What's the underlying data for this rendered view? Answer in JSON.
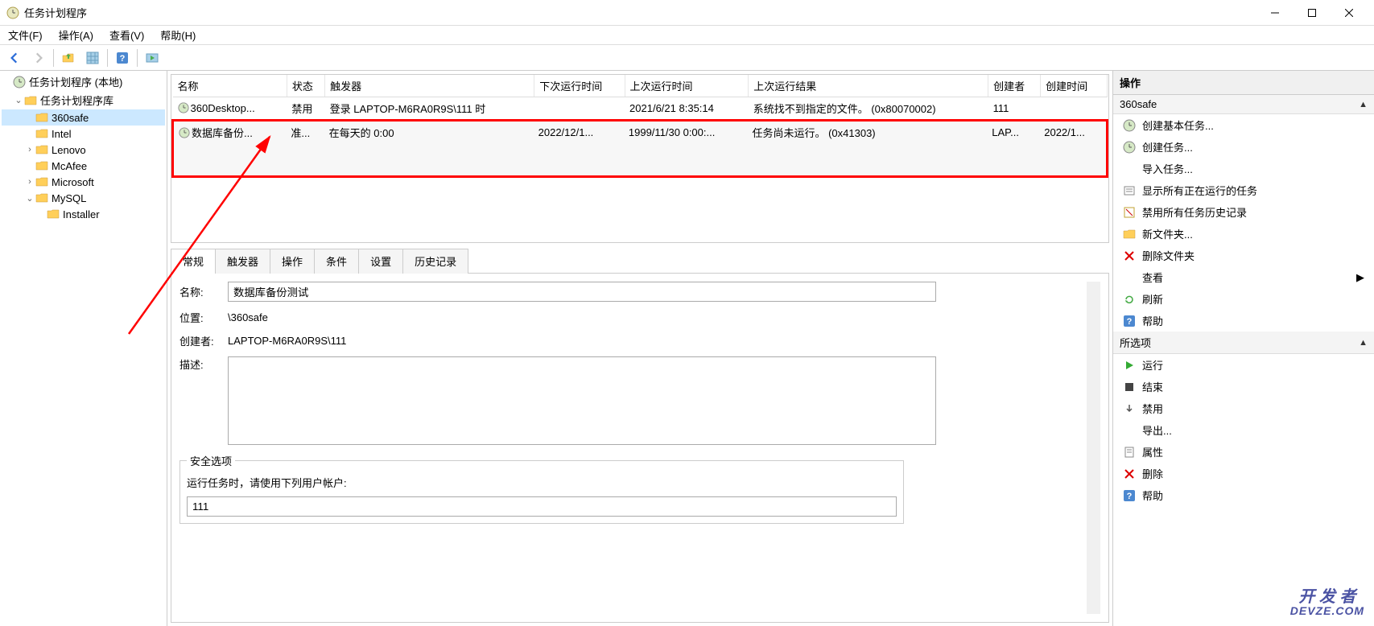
{
  "titlebar": {
    "title": "任务计划程序"
  },
  "menubar": {
    "file": "文件(F)",
    "action": "操作(A)",
    "view": "查看(V)",
    "help": "帮助(H)"
  },
  "tree": {
    "root": "任务计划程序 (本地)",
    "library": "任务计划程序库",
    "items": [
      "360safe",
      "Intel",
      "Lenovo",
      "McAfee",
      "Microsoft",
      "MySQL"
    ],
    "mysql_child": "Installer"
  },
  "columns": {
    "name": "名称",
    "status": "状态",
    "trigger": "触发器",
    "next": "下次运行时间",
    "last": "上次运行时间",
    "result": "上次运行结果",
    "creator": "创建者",
    "created": "创建时间"
  },
  "tasks": [
    {
      "name": "360Desktop...",
      "status": "禁用",
      "trigger": "登录 LAPTOP-M6RA0R9S\\111 时",
      "next": "",
      "last": "2021/6/21 8:35:14",
      "result": "系统找不到指定的文件。 (0x80070002)",
      "creator": "111",
      "created": ""
    },
    {
      "name": "数据库备份...",
      "status": "准...",
      "trigger": "在每天的 0:00",
      "next": "2022/12/1...",
      "last": "1999/11/30 0:00:...",
      "result": "任务尚未运行。 (0x41303)",
      "creator": "LAP...",
      "created": "2022/1..."
    }
  ],
  "tabs": {
    "general": "常规",
    "triggers": "触发器",
    "actions": "操作",
    "conditions": "条件",
    "settings": "设置",
    "history": "历史记录"
  },
  "detail": {
    "name_label": "名称:",
    "name_value": "数据库备份测试",
    "location_label": "位置:",
    "location_value": "\\360safe",
    "creator_label": "创建者:",
    "creator_value": "LAPTOP-M6RA0R9S\\111",
    "description_label": "描述:",
    "description_value": "",
    "security_group": "安全选项",
    "security_label": "运行任务时，请使用下列用户帐户:",
    "security_account": "111"
  },
  "actions_panel": {
    "header": "操作",
    "section1_title": "360safe",
    "items1": [
      "创建基本任务...",
      "创建任务...",
      "导入任务...",
      "显示所有正在运行的任务",
      "禁用所有任务历史记录",
      "新文件夹...",
      "删除文件夹",
      "查看",
      "刷新",
      "帮助"
    ],
    "section2_title": "所选项",
    "items2": [
      "运行",
      "结束",
      "禁用",
      "导出...",
      "属性",
      "删除",
      "帮助"
    ]
  },
  "watermark": {
    "line1": "开 发 者",
    "line2": "DEVZE.COM"
  }
}
